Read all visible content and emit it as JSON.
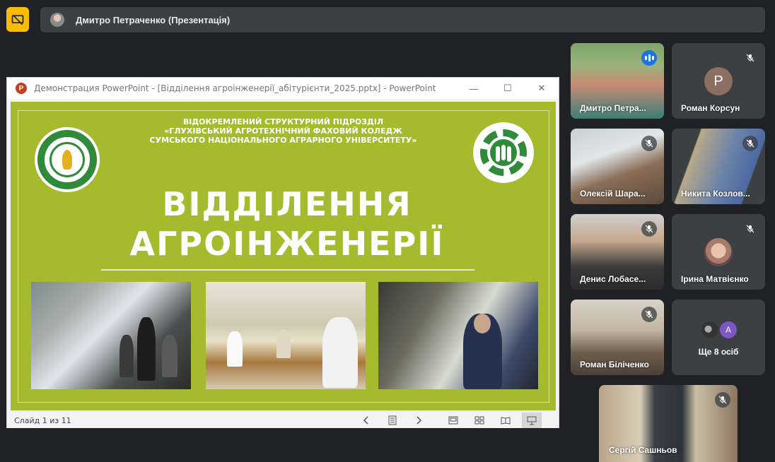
{
  "presenter": {
    "name": "Дмитро Петраченко (Презентація)"
  },
  "ppt": {
    "window_title": "Демонстрация PowerPoint - [Відділення агроінженерії_абітурієнти_2025.pptx] - PowerPoint",
    "app_letter": "P",
    "slide_counter": "Слайд 1 из 11",
    "controls": {
      "minimize": "—",
      "maximize": "☐",
      "close": "✕"
    }
  },
  "slide": {
    "header_lines": [
      "ВІДОКРЕМЛЕНИЙ СТРУКТУРНИЙ ПІДРОЗДІЛ",
      "«ГЛУХІВСЬКИЙ АГРОТЕХНІЧНИЙ ФАХОВИЙ КОЛЕДЖ",
      "СУМСЬКОГО НАЦІОНАЛЬНОГО АГРАРНОГО УНІВЕРСИТЕТУ»"
    ],
    "title_line1": "ВІДДІЛЕННЯ",
    "title_line2": "АГРОІНЖЕНЕРІЇ",
    "background": "#a6ba2e"
  },
  "participants": [
    {
      "name": "Дмитро Петра...",
      "state": "speaking"
    },
    {
      "name": "Роман Корсун",
      "state": "muted",
      "initial": "P",
      "avatar_color": "#8d6e63"
    },
    {
      "name": "Олексій Шара...",
      "state": "muted"
    },
    {
      "name": "Никита Козлов...",
      "state": "muted"
    },
    {
      "name": "Денис Лобасе...",
      "state": "muted"
    },
    {
      "name": "Ірина Матвієнко",
      "state": "muted"
    },
    {
      "name": "Роман Біліченко",
      "state": "muted"
    },
    {
      "name": "Сергій Сашньов",
      "state": "muted"
    }
  ],
  "more": {
    "label": "Ще 8 осіб",
    "avatar_initial": "A"
  },
  "colors": {
    "background": "#202124",
    "tile": "#3c4043",
    "accent_yellow": "#fbbc04",
    "speaking_blue": "#1a73e8"
  }
}
